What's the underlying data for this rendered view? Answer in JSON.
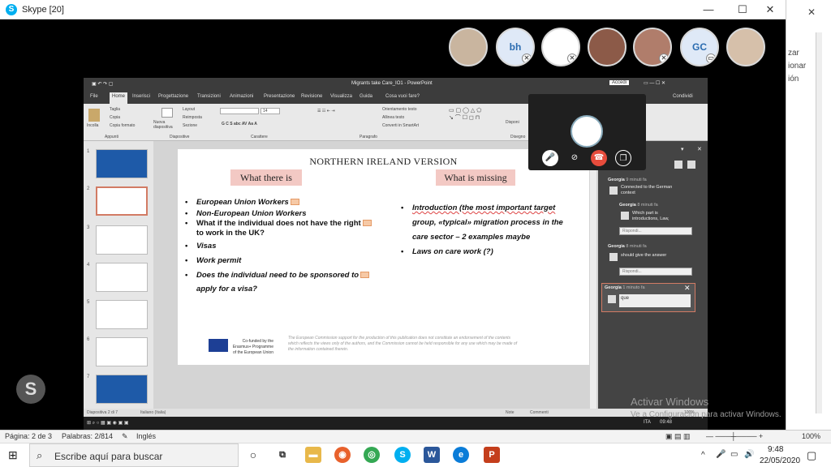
{
  "skype": {
    "title": "Skype [20]",
    "minimize": "—",
    "maximize": "☐",
    "close": "✕"
  },
  "participants": [
    {
      "initials": "",
      "kind": "photo",
      "color": "#c9b59f"
    },
    {
      "initials": "bh",
      "kind": "initials",
      "color": "#dfe9f7"
    },
    {
      "initials": "",
      "kind": "logo",
      "color": "#ffffff"
    },
    {
      "initials": "",
      "kind": "photo",
      "color": "#8c5a48"
    },
    {
      "initials": "",
      "kind": "photo",
      "color": "#b07d6b"
    },
    {
      "initials": "GC",
      "kind": "initials",
      "color": "#dfe9f7"
    },
    {
      "initials": "",
      "kind": "photo",
      "color": "#d6c0aa"
    }
  ],
  "right_app": {
    "text1": "zar",
    "text2": "ionar",
    "text3": "ión"
  },
  "ppt": {
    "title": "Migrants take Care_IO1 - PowerPoint",
    "sign_in": "Accedi",
    "tabs": [
      "File",
      "Home",
      "Inserisci",
      "Progettazione",
      "Transizioni",
      "Animazioni",
      "Presentazione",
      "Revisione",
      "Visualizza",
      "Guida",
      "Cosa vuoi fare?"
    ],
    "share": "Condividi",
    "ribbon_groups": [
      "Appunti",
      "Diapositive",
      "Carattere",
      "Paragrafo",
      "Disegno"
    ],
    "ribbon_items": {
      "paste": "Incolla",
      "cut": "Taglia",
      "copy": "Copia",
      "format": "Copia formato",
      "new_slide": "Nuova diapositiva",
      "layout": "Layout",
      "reset": "Reimposta",
      "section": "Sezione",
      "text_dir": "Orientamento testo",
      "align": "Allinea testo",
      "smartart": "Converti in SmartArt",
      "shapes": "Disponi"
    },
    "font_size": "14",
    "slide_numbers": [
      "1",
      "2",
      "3",
      "4",
      "5",
      "6",
      "7"
    ],
    "status": {
      "slide": "Diapositiva 2 di 7",
      "lang": "Italiano (Italia)",
      "notes": "Note",
      "comments": "Commenti",
      "zoom": "100%"
    }
  },
  "slide": {
    "heading": "NORTHERN IRELAND VERSION",
    "left_header": "What there is",
    "right_header": "What is missing",
    "left_bullets": [
      "European Union Workers",
      "Non-European Union Workers",
      "What if the individual does not have the right",
      "to work in the UK?",
      "Visas",
      "Work permit",
      "Does the individual need to be sponsored to",
      "apply for a visa?"
    ],
    "right_bullets": [
      "Introduction (the most important target",
      "group, «typical» migration process in the",
      "care sector – 2 examples maybe",
      "Laws on care work (?)"
    ],
    "cofund": [
      "Co-funded by the",
      "Erasmus+ Programme",
      "of the European Union"
    ],
    "disclaimer": [
      "The European Commission support for the production of this publication does not constitute an endorsement of the contents",
      "which reflects the views only of the authors, and the Commission cannot be held responsible for any use which may be made of",
      "the information contained therein."
    ]
  },
  "comments": [
    {
      "name": "Georgia",
      "time": "9 minuti fa",
      "text": [
        "Connected to the German",
        "context"
      ]
    },
    {
      "name": "Georgia",
      "time": "8 minuti fa",
      "text": [
        "Which part is",
        "introductions, Law,"
      ],
      "reply": "Rispondi..."
    },
    {
      "name": "Georgia",
      "time": "8 minuti fa",
      "text": [
        "should give the answer"
      ],
      "reply": "Rispondi..."
    },
    {
      "name": "Georgia",
      "time": "1 minuto fa",
      "text": [
        "que"
      ]
    }
  ],
  "watermark": {
    "line1": "Activar Windows",
    "line2": "Ve a Configuración para activar Windows."
  },
  "word_status": {
    "page": "Página: 2 de 3",
    "words": "Palabras: 2/814",
    "lang": "Inglés",
    "zoom": "100%"
  },
  "taskbar": {
    "search_placeholder": "Escribe aquí para buscar",
    "time": "9:48",
    "date": "22/05/2020",
    "ppt_time": "09:48",
    "ppt_lang": "ITA"
  },
  "colors": {
    "accent_pink": "#f3c9c4",
    "end_call": "#e74c3c",
    "skype_blue": "#00aff0"
  }
}
